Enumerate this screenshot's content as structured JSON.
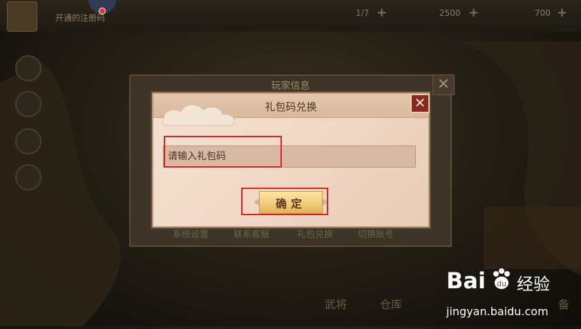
{
  "hud": {
    "tip": "开通的注册码",
    "resource_1": "1/7",
    "resource_2": "2500",
    "resource_3": "700"
  },
  "back_dialog": {
    "title": "玩家信息",
    "menu": [
      "系统设置",
      "联系客服",
      "礼包兑换",
      "切换账号"
    ]
  },
  "dialog": {
    "title": "礼包码兑换",
    "close_label": "✕",
    "input_placeholder": "请输入礼包码",
    "input_value": "",
    "confirm_label": "确定"
  },
  "bottom_nav": [
    "武将",
    "仓库",
    "备"
  ],
  "watermark": {
    "brand": "Bai",
    "brand_suffix": "经验",
    "url": "jingyan.baidu.com"
  },
  "colors": {
    "highlight": "#e02020",
    "close_button": "#8a2a1e",
    "confirm_button": "#f0c976"
  }
}
